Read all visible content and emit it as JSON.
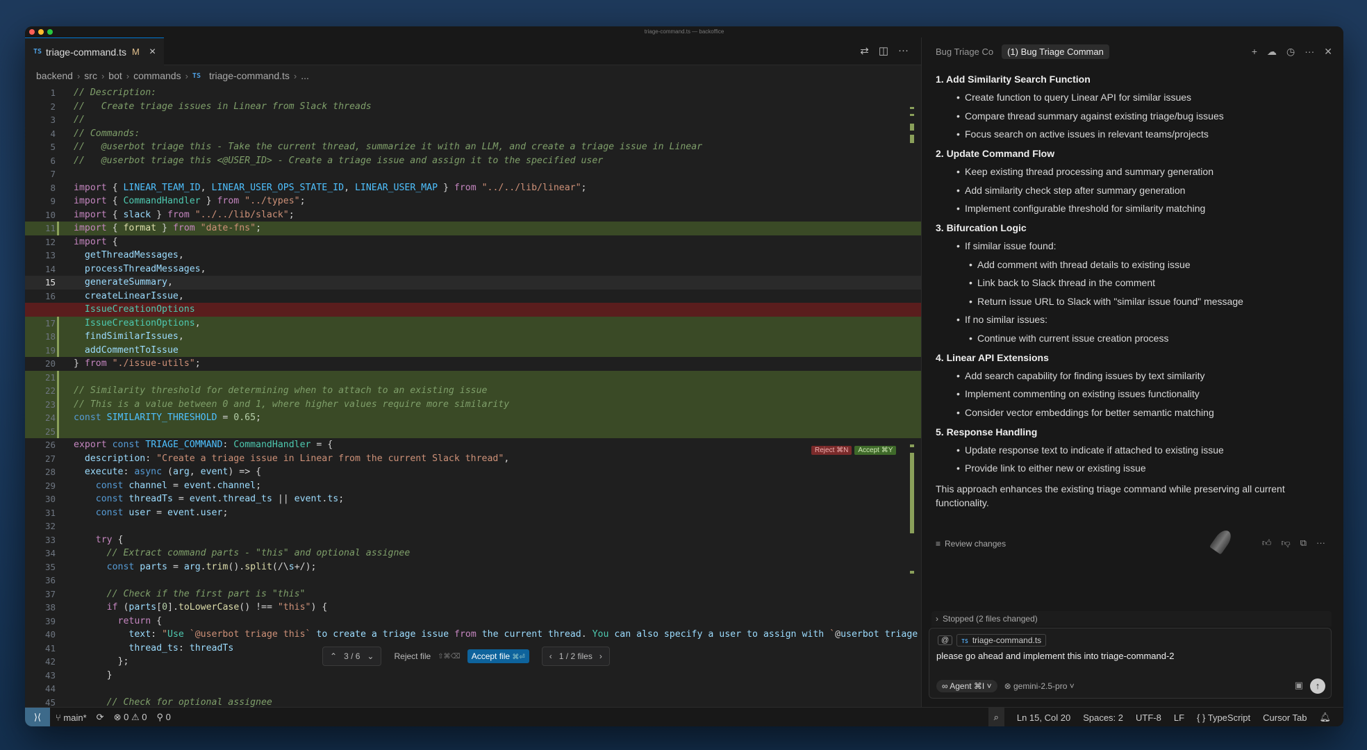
{
  "window": {
    "title": "triage-command.ts — backoffice"
  },
  "colors": {
    "accent": "#0078d4",
    "added": "#3a4a26",
    "removed": "#5a1d1d"
  },
  "editor": {
    "tab": {
      "badge": "TS",
      "name": "triage-command.ts",
      "modified": "M",
      "close": "×"
    },
    "breadcrumb": [
      "backend",
      "src",
      "bot",
      "commands",
      "TS",
      "triage-command.ts",
      "..."
    ],
    "reject_label": "Reject ⌘N",
    "accept_label": "Accept ⌘Y",
    "diffnav": {
      "hunks": "3 / 6",
      "reject_file": "Reject file",
      "reject_kbd": "⇧⌘⌫",
      "accept_file": "Accept file",
      "accept_kbd": "⌘⏎",
      "files": "1 / 2 files"
    }
  },
  "code": [
    {
      "n": "1",
      "t": "// Description:"
    },
    {
      "n": "2",
      "t": "//   Create triage issues in Linear from Slack threads"
    },
    {
      "n": "3",
      "t": "//"
    },
    {
      "n": "4",
      "t": "// Commands:"
    },
    {
      "n": "5",
      "t": "//   @userbot triage this - Take the current thread, summarize it with an LLM, and create a triage issue in Linear"
    },
    {
      "n": "6",
      "t": "//   @userbot triage this <@USER_ID> - Create a triage issue and assign it to the specified user"
    },
    {
      "n": "7",
      "t": ""
    },
    {
      "n": "8",
      "t": "import { LINEAR_TEAM_ID, LINEAR_USER_OPS_STATE_ID, LINEAR_USER_MAP } from \"../../lib/linear\";"
    },
    {
      "n": "9",
      "t": "import { CommandHandler } from \"../types\";"
    },
    {
      "n": "10",
      "t": "import { slack } from \"../../lib/slack\";"
    },
    {
      "n": "11",
      "t": "import { format } from \"date-fns\";"
    },
    {
      "n": "12",
      "t": "import {"
    },
    {
      "n": "13",
      "t": "  getThreadMessages,"
    },
    {
      "n": "14",
      "t": "  processThreadMessages,"
    },
    {
      "n": "15",
      "t": "  generateSummary,"
    },
    {
      "n": "16",
      "t": "  createLinearIssue,"
    },
    {
      "n": "",
      "t": "  IssueCreationOptions"
    },
    {
      "n": "17",
      "t": "  IssueCreationOptions,"
    },
    {
      "n": "18",
      "t": "  findSimilarIssues,"
    },
    {
      "n": "19",
      "t": "  addCommentToIssue"
    },
    {
      "n": "20",
      "t": "} from \"./issue-utils\";"
    },
    {
      "n": "21",
      "t": ""
    },
    {
      "n": "22",
      "t": "// Similarity threshold for determining when to attach to an existing issue"
    },
    {
      "n": "23",
      "t": "// This is a value between 0 and 1, where higher values require more similarity"
    },
    {
      "n": "24",
      "t": "const SIMILARITY_THRESHOLD = 0.65;"
    },
    {
      "n": "25",
      "t": ""
    },
    {
      "n": "26",
      "t": "export const TRIAGE_COMMAND: CommandHandler = {"
    },
    {
      "n": "27",
      "t": "  description: \"Create a triage issue in Linear from the current Slack thread\","
    },
    {
      "n": "28",
      "t": "  execute: async (arg, event) => {"
    },
    {
      "n": "29",
      "t": "    const channel = event.channel;"
    },
    {
      "n": "30",
      "t": "    const threadTs = event.thread_ts || event.ts;"
    },
    {
      "n": "31",
      "t": "    const user = event.user;"
    },
    {
      "n": "32",
      "t": ""
    },
    {
      "n": "33",
      "t": "    try {"
    },
    {
      "n": "34",
      "t": "      // Extract command parts - \"this\" and optional assignee"
    },
    {
      "n": "35",
      "t": "      const parts = arg.trim().split(/\\s+/);"
    },
    {
      "n": "36",
      "t": ""
    },
    {
      "n": "37",
      "t": "      // Check if the first part is \"this\""
    },
    {
      "n": "38",
      "t": "      if (parts[0].toLowerCase() !== \"this\") {"
    },
    {
      "n": "39",
      "t": "        return {"
    },
    {
      "n": "40",
      "t": "          text: \"Use `@userbot triage this` to create a triage issue from the current thread. You can also specify a user to assign with `@userbot triage t"
    },
    {
      "n": "41",
      "t": "          thread_ts: threadTs"
    },
    {
      "n": "42",
      "t": "        };"
    },
    {
      "n": "43",
      "t": "      }"
    },
    {
      "n": "44",
      "t": ""
    },
    {
      "n": "45",
      "t": "      // Check for optional assignee"
    }
  ],
  "chat": {
    "tabs": [
      "Bug Triage Co",
      "(1) Bug Triage Comman"
    ],
    "sections": [
      {
        "title": "1. Add Similarity Search Function",
        "items": [
          {
            "lvl": 1,
            "t": "Create function to query Linear API for similar issues"
          },
          {
            "lvl": 1,
            "t": "Compare thread summary against existing triage/bug issues"
          },
          {
            "lvl": 1,
            "t": "Focus search on active issues in relevant teams/projects"
          }
        ]
      },
      {
        "title": "2. Update Command Flow",
        "items": [
          {
            "lvl": 1,
            "t": "Keep existing thread processing and summary generation"
          },
          {
            "lvl": 1,
            "t": "Add similarity check step after summary generation"
          },
          {
            "lvl": 1,
            "t": "Implement configurable threshold for similarity matching"
          }
        ]
      },
      {
        "title": "3. Bifurcation Logic",
        "items": [
          {
            "lvl": 1,
            "t": "If similar issue found:"
          },
          {
            "lvl": 2,
            "t": "Add comment with thread details to existing issue"
          },
          {
            "lvl": 2,
            "t": "Link back to Slack thread in the comment"
          },
          {
            "lvl": 2,
            "t": "Return issue URL to Slack with \"similar issue found\" message"
          },
          {
            "lvl": 1,
            "t": "If no similar issues:"
          },
          {
            "lvl": 2,
            "t": "Continue with current issue creation process"
          }
        ]
      },
      {
        "title": "4. Linear API Extensions",
        "items": [
          {
            "lvl": 1,
            "t": "Add search capability for finding issues by text similarity"
          },
          {
            "lvl": 1,
            "t": "Implement commenting on existing issues functionality"
          },
          {
            "lvl": 1,
            "t": "Consider vector embeddings for better semantic matching"
          }
        ]
      },
      {
        "title": "5. Response Handling",
        "items": [
          {
            "lvl": 1,
            "t": "Update response text to indicate if attached to existing issue"
          },
          {
            "lvl": 1,
            "t": "Provide link to either new or existing issue"
          }
        ]
      }
    ],
    "closing": "This approach enhances the existing triage command while preserving all current functionality.",
    "review": "Review changes",
    "stopped": "Stopped (2 files changed)",
    "composer": {
      "context_file": "triage-command.ts",
      "context_badge": "TS",
      "prompt": "please go ahead and implement this into triage-command-2",
      "mode": "Agent ⌘I",
      "model": "gemini-2.5-pro"
    }
  },
  "status": {
    "branch": "main*",
    "errors": "0",
    "warnings": "0",
    "ports": "0",
    "position": "Ln 15, Col 20",
    "spaces": "Spaces: 2",
    "encoding": "UTF-8",
    "eol": "LF",
    "language": "TypeScript",
    "cursor_tab": "Cursor Tab"
  }
}
